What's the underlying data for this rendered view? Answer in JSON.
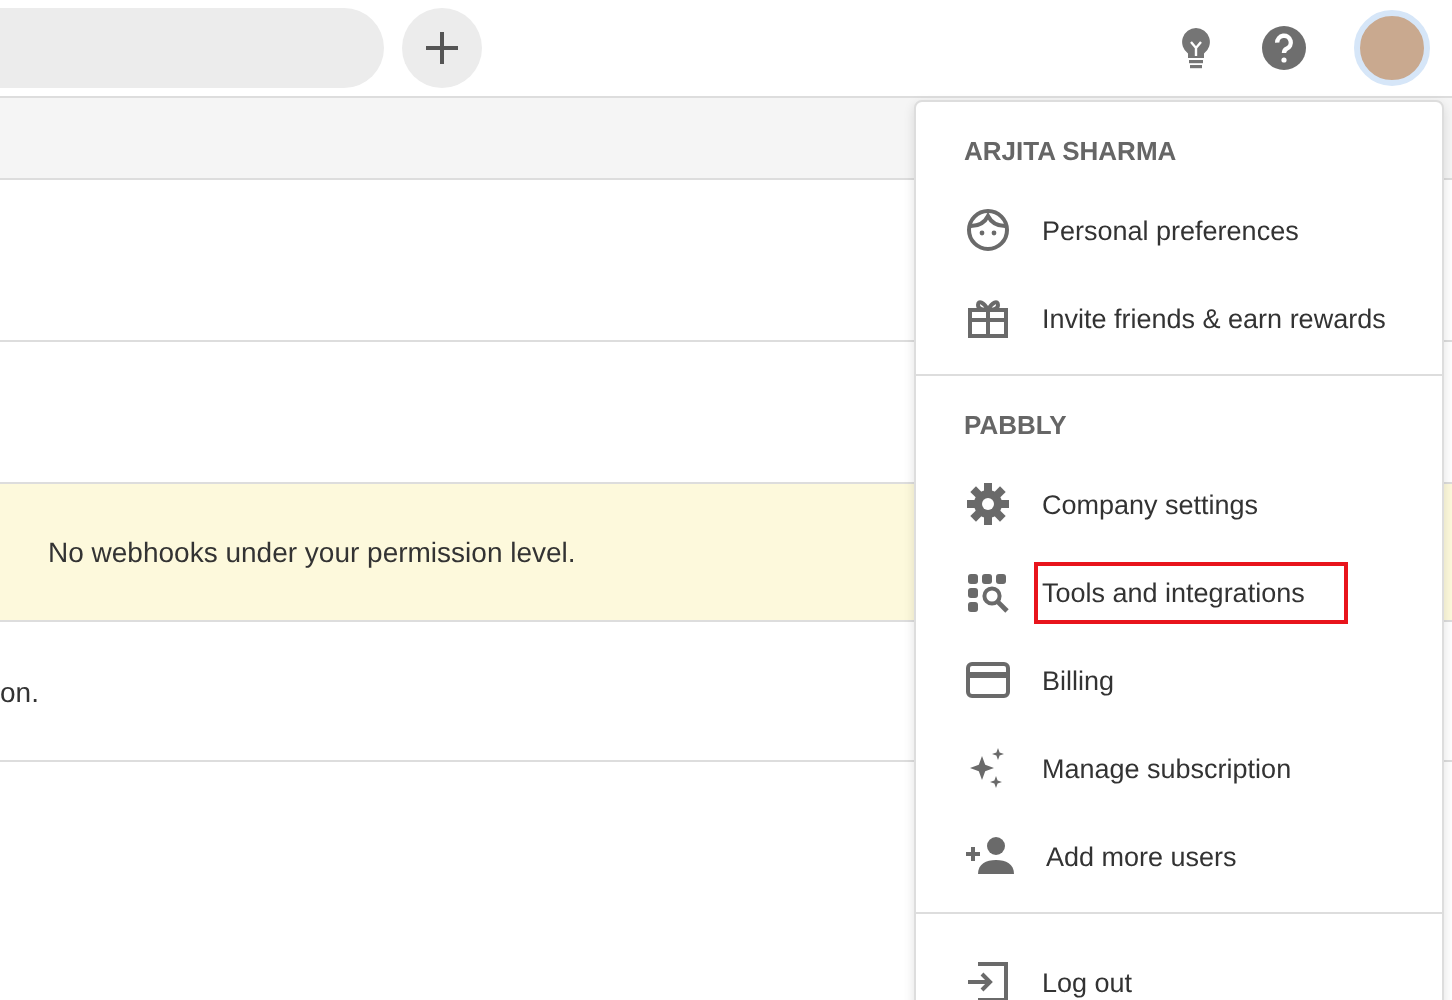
{
  "content": {
    "notice": "No webhooks under your permission level.",
    "row_text": "on."
  },
  "menu": {
    "sections": [
      {
        "title": "ARJITA SHARMA",
        "items": [
          {
            "kind": "face",
            "label": "Personal preferences",
            "highlighted": false
          },
          {
            "kind": "gift",
            "label": "Invite friends & earn rewards",
            "highlighted": false
          }
        ]
      },
      {
        "title": "PABBLY",
        "items": [
          {
            "kind": "gear",
            "label": "Company settings",
            "highlighted": false
          },
          {
            "kind": "tools",
            "label": "Tools and integrations",
            "highlighted": true
          },
          {
            "kind": "card",
            "label": "Billing",
            "highlighted": false
          },
          {
            "kind": "sparkle",
            "label": "Manage subscription",
            "highlighted": false
          },
          {
            "kind": "user-add",
            "label": "Add more users",
            "highlighted": false
          }
        ]
      },
      {
        "items": [
          {
            "kind": "logout",
            "label": "Log out",
            "highlighted": false
          }
        ]
      }
    ]
  }
}
